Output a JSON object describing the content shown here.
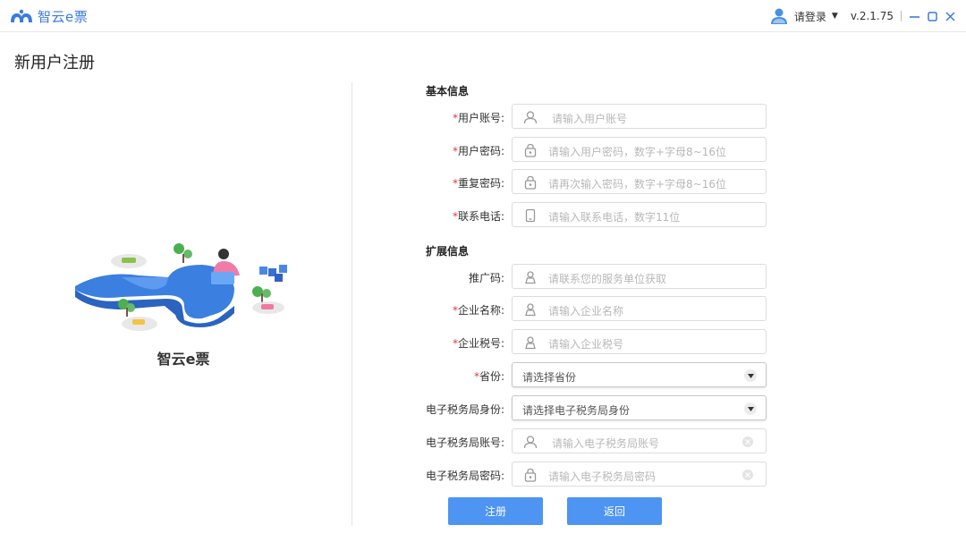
{
  "app": {
    "name": "智云e票",
    "version": "v.2.1.75"
  },
  "header": {
    "login_label": "请登录"
  },
  "page": {
    "title": "新用户注册"
  },
  "illustration": {
    "caption": "智云e票"
  },
  "sections": {
    "basic": "基本信息",
    "extended": "扩展信息"
  },
  "form": {
    "username": {
      "required": "*",
      "label": "用户账号:",
      "placeholder": "请输入用户账号"
    },
    "password": {
      "required": "*",
      "label": "用户密码:",
      "placeholder": "请输入用户密码，数字+字母8~16位"
    },
    "repeat_password": {
      "required": "*",
      "label": "重复密码:",
      "placeholder": "请再次输入密码，数字+字母8~16位"
    },
    "phone": {
      "required": "*",
      "label": "联系电话:",
      "placeholder": "请输入联系电话，数字11位"
    },
    "promo_code": {
      "label": "推广码:",
      "placeholder": "请联系您的服务单位获取"
    },
    "company_name": {
      "required": "*",
      "label": "企业名称:",
      "placeholder": "请输入企业名称"
    },
    "tax_id": {
      "required": "*",
      "label": "企业税号:",
      "placeholder": "请输入企业税号"
    },
    "province": {
      "required": "*",
      "label": "省份:",
      "placeholder": "请选择省份"
    },
    "etax_identity": {
      "label": "电子税务局身份:",
      "placeholder": "请选择电子税务局身份"
    },
    "etax_account": {
      "label": "电子税务局账号:",
      "placeholder": "请输入电子税务局账号"
    },
    "etax_password": {
      "label": "电子税务局密码:",
      "placeholder": "请输入电子税务局密码"
    }
  },
  "buttons": {
    "register": "注册",
    "back": "返回"
  },
  "colors": {
    "brand": "#3a7be0",
    "button": "#4d94f3",
    "required": "#e23b3b"
  }
}
